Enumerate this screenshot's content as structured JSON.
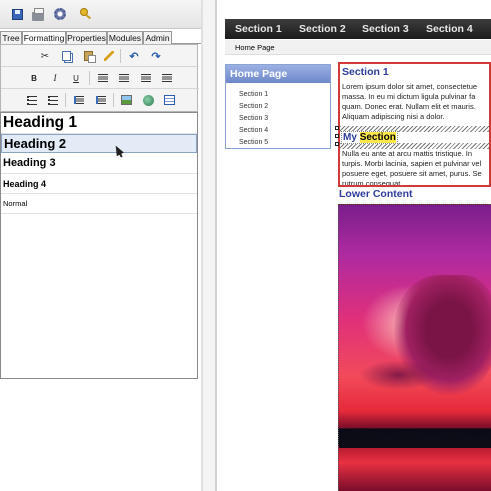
{
  "editor": {
    "tabs": [
      "Tree",
      "Formatting",
      "Properties",
      "Modules",
      "Admin"
    ],
    "active_tab": "Formatting",
    "toolbar_icons": [
      "save-icon",
      "print-icon",
      "settings-icon",
      "key-icon"
    ],
    "tool_rows": [
      [
        "cut-icon",
        "copy-icon",
        "paste-icon",
        "clear-format-icon",
        "undo-icon",
        "redo-icon"
      ],
      [
        "bold-icon",
        "italic-icon",
        "underline-icon",
        "align-left-icon",
        "align-center-icon",
        "align-right-icon",
        "justify-icon"
      ],
      [
        "bullet-list-icon",
        "numbered-list-icon",
        "outdent-icon",
        "indent-icon",
        "image-icon",
        "link-icon",
        "table-icon"
      ]
    ],
    "format_glyphs": {
      "bold": "B",
      "italic": "I",
      "underline": "U"
    },
    "formats": [
      "Heading 1",
      "Heading 2",
      "Heading 3",
      "Heading 4",
      "Normal"
    ],
    "selected_format": "Heading 2"
  },
  "site": {
    "nav": [
      "Section 1",
      "Section 2",
      "Section 3",
      "Section 4"
    ],
    "breadcrumb": "Home Page",
    "side_nav": {
      "title": "Home Page",
      "links": [
        "Section 1",
        "Section 2",
        "Section 3",
        "Section 4",
        "Section 5"
      ]
    },
    "content": {
      "heading": "Section 1",
      "para1_lines": [
        "Lorem ipsum dolor sit amet, consectetue",
        "massa. In eu mi dictum ligula pulvinar fa",
        "quam. Donec erat. Nullam elit et mauris.",
        "Aliquam adipiscing nisi a dolor."
      ],
      "my_section_prefix": "My",
      "my_section_highlight": "Section",
      "para2_lines": [
        "Nulla eu ante at arcu mattis tristique. In",
        "turpis. Morbi lacinia, sapien et pulvinar vel",
        "posuere eget, posuere sit amet, purus. Se",
        "rutrum consequat."
      ]
    },
    "lower_heading": "Lower Content",
    "colors": {
      "nav_bg": "#2a2a2a",
      "heading": "#2c3c9c",
      "content_border": "#d23a3a",
      "highlight": "#ffe84a",
      "side_nav_header": "#7d94d4"
    }
  }
}
